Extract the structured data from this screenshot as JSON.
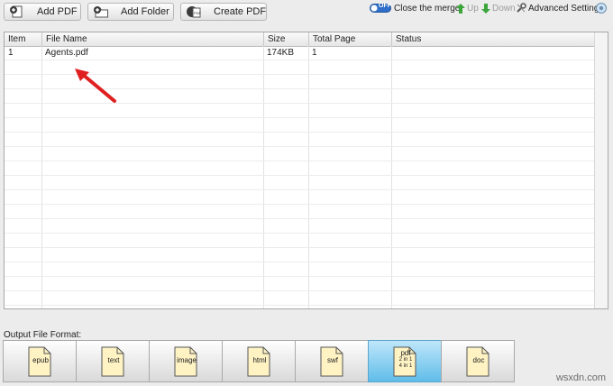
{
  "toolbar": {
    "add_pdf": "Add PDF",
    "add_folder": "Add Folder",
    "create_pdf": "Create PDF"
  },
  "top_right": {
    "toggle_state": "OFF",
    "close_merger": "Close the merger",
    "up": "Up",
    "down": "Down",
    "advanced_settings": "Advanced Settings"
  },
  "table": {
    "columns": [
      "Item",
      "File Name",
      "Size",
      "Total Page",
      "Status"
    ],
    "rows": [
      {
        "item": "1",
        "file_name": "Agents.pdf",
        "size": "174KB",
        "total_page": "1",
        "status": ""
      }
    ]
  },
  "output_format": {
    "label": "Output File Format:",
    "options": [
      "epub",
      "text",
      "image",
      "html",
      "swf",
      "pdf",
      "doc"
    ],
    "selected": "pdf",
    "pdf_lines": [
      "2 in 1",
      "4 in 1"
    ]
  },
  "watermark": "wsxdn.com",
  "colors": {
    "selected_format": "#5fbde8",
    "arrow": "#e02020",
    "up_arrow": "#3aa53a",
    "down_arrow": "#3aa53a",
    "toggle": "#2f6fc9"
  },
  "icons": {
    "add_pdf": "add-pdf-icon",
    "add_folder": "add-folder-icon",
    "create_pdf": "create-pdf-icon",
    "help": "help-icon",
    "advanced": "wrench-icon"
  }
}
